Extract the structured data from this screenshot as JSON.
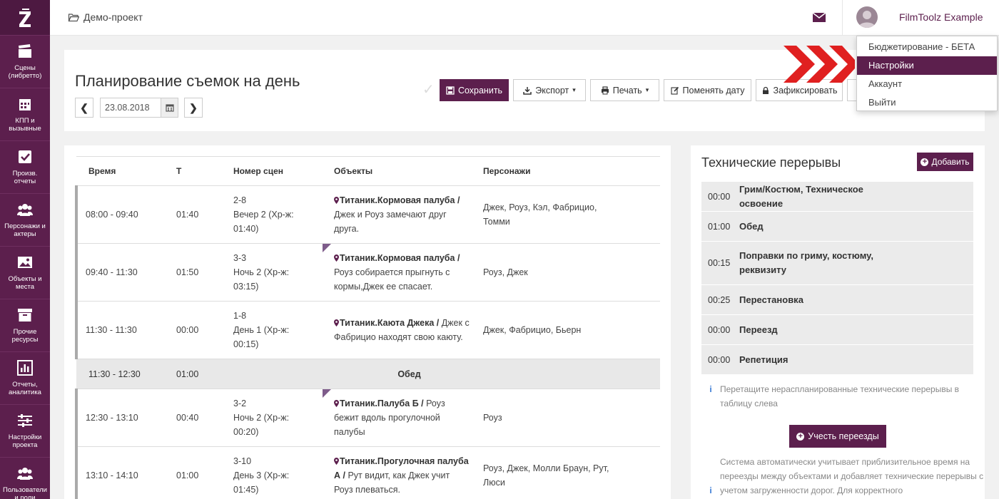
{
  "colors": {
    "accent": "#5c1f4d",
    "arrows": "#e02020"
  },
  "project": {
    "name": "Демо-проект",
    "icon": "folder-open-icon"
  },
  "user": {
    "name": "FilmToolz Example"
  },
  "sidebar": {
    "items": [
      {
        "label": "Сцены (либретто)",
        "icon": "clapperboard-icon"
      },
      {
        "label": "КПП и вызывные",
        "icon": "calendar-icon"
      },
      {
        "label": "Произв. отчеты",
        "icon": "checkbox-icon"
      },
      {
        "label": "Персонажи и актеры",
        "icon": "users-icon"
      },
      {
        "label": "Объекты и места",
        "icon": "image-icon"
      },
      {
        "label": "Прочие ресурсы",
        "icon": "archive-icon"
      },
      {
        "label": "Отчеты, аналитика",
        "icon": "bar-chart-icon"
      },
      {
        "label": "Настройки проекта",
        "icon": "sliders-icon"
      },
      {
        "label": "Пользователи и роли",
        "icon": "users-icon"
      }
    ]
  },
  "menu": {
    "items": [
      "Бюджетирование - БЕТА",
      "Настройки",
      "Аккаунт",
      "Выйти"
    ],
    "active": "Настройки"
  },
  "header": {
    "title": "Планирование съемок на день",
    "date": "23.08.2018",
    "prev": "❮",
    "next": "❯",
    "buttons": {
      "save": "Сохранить",
      "export": "Экспорт",
      "print": "Печать",
      "change_date": "Поменять дату",
      "lock": "Зафиксировать"
    }
  },
  "schedule": {
    "columns": [
      "Время",
      "Т",
      "Номер сцен",
      "Объекты",
      "Персонажи"
    ],
    "rows": [
      {
        "type": "scene",
        "time": "08:00 - 09:40",
        "t": "01:40",
        "scene": "2-8",
        "scene_note": "Вечер 2 (Хр-ж: 01:40)",
        "object": "Титаник.Кормовая палуба /",
        "desc": "Джек и Роуз замечают друг друга.",
        "chars": "Джек, Роуз, Кэл, Фабрицио, Томми",
        "marked": false
      },
      {
        "type": "scene",
        "time": "09:40 - 11:30",
        "t": "01:50",
        "scene": "3-3",
        "scene_note": "Ночь 2 (Хр-ж: 03:15)",
        "object": "Титаник.Кормовая палуба /",
        "desc": "Роуз собирается прыгнуть с кормы,Джек ее спасает.",
        "chars": "Роуз, Джек",
        "marked": true
      },
      {
        "type": "scene",
        "time": "11:30 - 11:30",
        "t": "00:00",
        "scene": "1-8",
        "scene_note": "День 1 (Хр-ж: 00:15)",
        "object": "Титаник.Каюта Джека /",
        "desc": "Джек с Фабрицио находят свою каюту.",
        "chars": "Джек, Фабрицио, Бьерн",
        "marked": false
      },
      {
        "type": "lunch",
        "time": "11:30 - 12:30",
        "t": "01:00",
        "label": "Обед"
      },
      {
        "type": "scene",
        "time": "12:30 - 13:10",
        "t": "00:40",
        "scene": "3-2",
        "scene_note": "Ночь 2 (Хр-ж: 00:20)",
        "object": "Титаник.Палуба Б /",
        "desc": "Роуз бежит вдоль прогулочной палубы",
        "chars": "Роуз",
        "marked": true
      },
      {
        "type": "scene",
        "time": "13:10 - 14:10",
        "t": "01:00",
        "scene": "3-10",
        "scene_note": "День 3 (Хр-ж: 01:45)",
        "object": "Титаник.Прогулочная палуба А /",
        "desc": "Рут видит, как Джек учит Роуз плеваться.",
        "chars": "Роуз, Джек, Молли Браун, Рут, Люси",
        "marked": false
      }
    ]
  },
  "breaks": {
    "title": "Технические перерывы",
    "add_label": "Добавить",
    "items": [
      {
        "time": "00:00",
        "name": "Грим/Костюм, Техническое освоение"
      },
      {
        "time": "01:00",
        "name": "Обед"
      },
      {
        "time": "00:15",
        "name": "Поправки по гриму, костюму, реквизиту"
      },
      {
        "time": "00:25",
        "name": "Перестановка"
      },
      {
        "time": "00:00",
        "name": "Переезд"
      },
      {
        "time": "00:00",
        "name": "Репетиция"
      }
    ],
    "hint": "Перетащите нераспланированные технические перерывы в таблицу слева",
    "account_label": "Учесть переезды",
    "note": "Система автоматически учитывает приблизительное время на переезды между объектами и добавляет технические перерывы с учетом загруженности дорог. Для корректного"
  }
}
